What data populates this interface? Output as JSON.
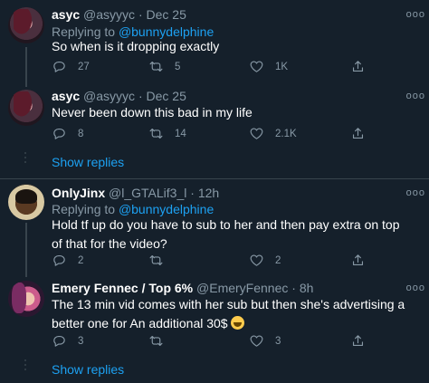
{
  "tweets": [
    {
      "name": "asyc",
      "handle": "@asyyyc",
      "sep": "·",
      "time": "Dec 25",
      "replying_prefix": "Replying to",
      "replying_to": "@bunnydelphine",
      "text": "So when is it dropping exactly",
      "replies": "27",
      "retweets": "5",
      "likes": "1K"
    },
    {
      "name": "asyc",
      "handle": "@asyyyc",
      "sep": "·",
      "time": "Dec 25",
      "text": "Never been down this bad in my life",
      "replies": "8",
      "retweets": "14",
      "likes": "2.1K"
    },
    {
      "name": "OnlyJinx",
      "handle": "@l_GTALif3_l",
      "sep": "·",
      "time": "12h",
      "replying_prefix": "Replying to",
      "replying_to": "@bunnydelphine",
      "text": "Hold tf up do you have to sub to her and then pay extra on top of that for the video?",
      "replies": "2",
      "retweets": "",
      "likes": "2"
    },
    {
      "name": "Emery Fennec / Top 6%",
      "handle": "@EmeryFennec",
      "sep": "·",
      "time": "8h",
      "text": "The 13 min vid comes with her sub but then she's advertising a better one for An additional 30$",
      "replies": "3",
      "retweets": "",
      "likes": "3"
    }
  ],
  "more_glyph": "ooo",
  "show_replies": "Show replies",
  "icons": {
    "reply": "reply-icon",
    "retweet": "retweet-icon",
    "like": "heart-icon",
    "share": "share-icon",
    "emoji": "grinning-sweat-emoji"
  },
  "colors": {
    "background": "#15202b",
    "link": "#1da1f2",
    "muted": "#8899a6",
    "divider": "#38444d"
  }
}
